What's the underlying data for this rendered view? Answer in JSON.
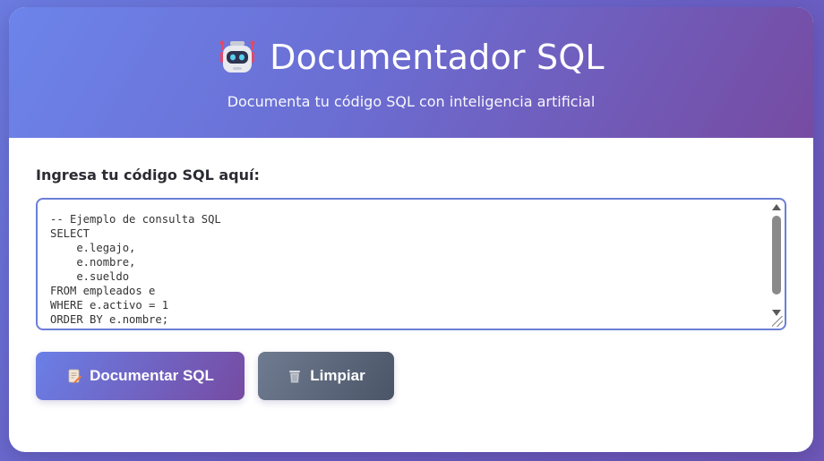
{
  "header": {
    "title": "Documentador SQL",
    "subtitle": "Documenta tu código SQL con inteligencia artificial",
    "icon": "robot-icon"
  },
  "form": {
    "label": "Ingresa tu código SQL aquí:",
    "code": "-- Ejemplo de consulta SQL\nSELECT\n    e.legajo,\n    e.nombre,\n    e.sueldo\nFROM empleados e\nWHERE e.activo = 1\nORDER BY e.nombre;"
  },
  "actions": {
    "document_label": "Documentar SQL",
    "document_icon": "memo-icon",
    "clear_label": "Limpiar",
    "clear_icon": "trash-icon"
  },
  "colors": {
    "accent": "#667eea",
    "accent_end": "#764ba2",
    "secondary": "#4b5568"
  }
}
